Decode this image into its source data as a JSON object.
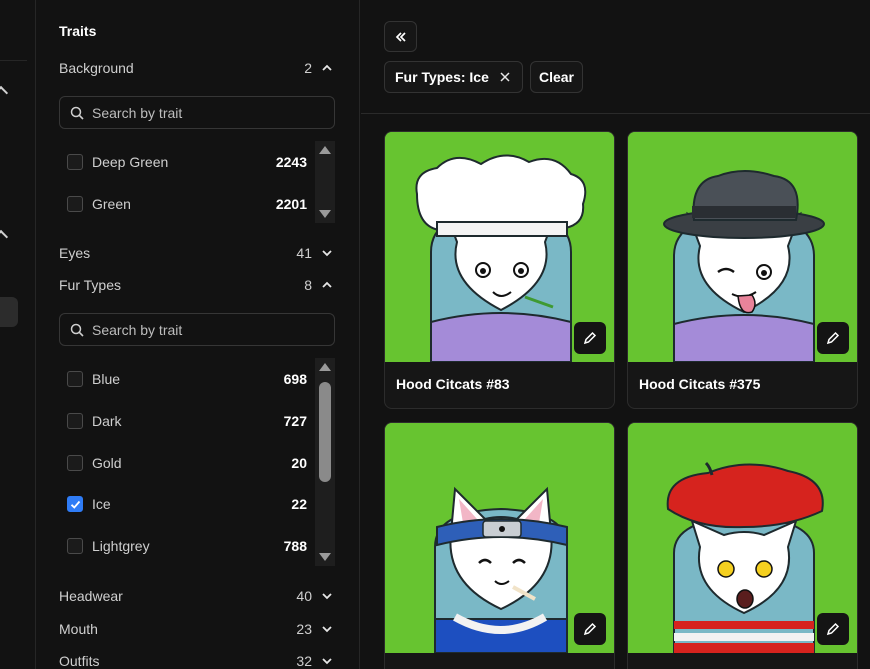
{
  "sidebar": {
    "title": "Traits",
    "background": {
      "label": "Background",
      "count": "2",
      "search_placeholder": "Search by trait",
      "options": [
        {
          "label": "Deep Green",
          "count": "2243",
          "checked": false
        },
        {
          "label": "Green",
          "count": "2201",
          "checked": false
        }
      ]
    },
    "eyes": {
      "label": "Eyes",
      "count": "41"
    },
    "fur_types": {
      "label": "Fur Types",
      "count": "8",
      "search_placeholder": "Search by trait",
      "options": [
        {
          "label": "Blue",
          "count": "698",
          "checked": false
        },
        {
          "label": "Dark",
          "count": "727",
          "checked": false
        },
        {
          "label": "Gold",
          "count": "20",
          "checked": false
        },
        {
          "label": "Ice",
          "count": "22",
          "checked": true
        },
        {
          "label": "Lightgrey",
          "count": "788",
          "checked": false
        }
      ]
    },
    "headwear": {
      "label": "Headwear",
      "count": "40"
    },
    "mouth": {
      "label": "Mouth",
      "count": "23"
    },
    "outfits": {
      "label": "Outfits",
      "count": "32"
    }
  },
  "main": {
    "active_filter": "Fur Types: Ice",
    "clear_label": "Clear",
    "cards": [
      {
        "name": "Hood Citcats #83",
        "hat": "chef-hat",
        "outfit": "lavender-sweater"
      },
      {
        "name": "Hood Citcats #375",
        "hat": "fedora",
        "outfit": "lavender-sweater"
      },
      {
        "name": "",
        "hat": "headband",
        "outfit": "blue-jacket"
      },
      {
        "name": "",
        "hat": "beret",
        "outfit": "red-stripe-shirt"
      }
    ]
  },
  "colors": {
    "accent": "#2f7cf6",
    "card_bg": "#67c430",
    "fur": "#7ab8c6"
  }
}
